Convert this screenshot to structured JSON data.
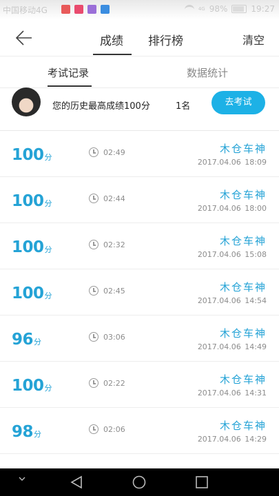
{
  "status_bar": {
    "carrier": "中国移动4G",
    "network": "4G",
    "battery": "98%",
    "time": "19:27"
  },
  "nav": {
    "tabs": [
      "成绩",
      "排行榜"
    ],
    "clear_label": "清空"
  },
  "subtabs": [
    "考试记录",
    "数据统计"
  ],
  "summary": {
    "text": "您的历史最高成绩100分",
    "rank": "1名",
    "button": "去考试"
  },
  "records": [
    {
      "score": "100",
      "unit": "分",
      "duration": "02:49",
      "name": "木仓车神",
      "date": "2017.04.06",
      "time": "18:09"
    },
    {
      "score": "100",
      "unit": "分",
      "duration": "02:44",
      "name": "木仓车神",
      "date": "2017.04.06",
      "time": "18:00"
    },
    {
      "score": "100",
      "unit": "分",
      "duration": "02:32",
      "name": "木仓车神",
      "date": "2017.04.06",
      "time": "15:08"
    },
    {
      "score": "100",
      "unit": "分",
      "duration": "02:45",
      "name": "木仓车神",
      "date": "2017.04.06",
      "time": "14:54"
    },
    {
      "score": "96",
      "unit": "分",
      "duration": "03:06",
      "name": "木仓车神",
      "date": "2017.04.06",
      "time": "14:49"
    },
    {
      "score": "100",
      "unit": "分",
      "duration": "02:22",
      "name": "木仓车神",
      "date": "2017.04.06",
      "time": "14:31"
    },
    {
      "score": "98",
      "unit": "分",
      "duration": "02:06",
      "name": "木仓车神",
      "date": "2017.04.06",
      "time": "14:29"
    }
  ],
  "colors": {
    "accent": "#25a3d6",
    "button": "#1db1e6"
  },
  "icons": {
    "back": "arrow-left-icon",
    "clock": "clock-icon",
    "sys_down": "chevron-down-icon",
    "sys_back": "triangle-back-icon",
    "sys_home": "circle-home-icon",
    "sys_recent": "square-recent-icon"
  }
}
